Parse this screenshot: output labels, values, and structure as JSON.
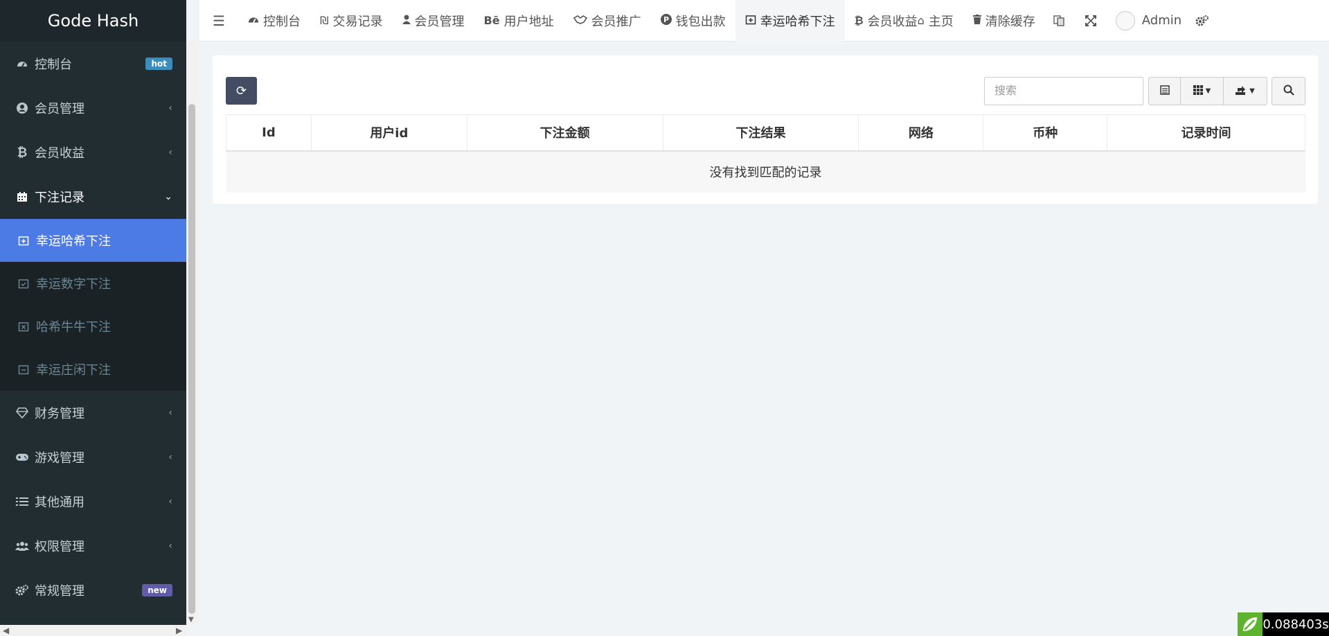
{
  "brand": "Gode Hash",
  "sidebar": {
    "items": [
      {
        "label": "控制台",
        "icon": "dashboard-icon",
        "badge": "hot"
      },
      {
        "label": "会员管理",
        "icon": "user-circle-icon"
      },
      {
        "label": "会员收益",
        "icon": "bitcoin-icon"
      },
      {
        "label": "下注记录",
        "icon": "calendar-icon",
        "open": true
      },
      {
        "label": "财务管理",
        "icon": "diamond-icon"
      },
      {
        "label": "游戏管理",
        "icon": "gamepad-icon"
      },
      {
        "label": "其他通用",
        "icon": "list-icon"
      },
      {
        "label": "权限管理",
        "icon": "users-icon"
      },
      {
        "label": "常规管理",
        "icon": "cogs-icon",
        "badge": "new"
      }
    ],
    "sub_items": [
      {
        "label": "幸运哈希下注",
        "icon": "calendar-plus-icon",
        "active": true
      },
      {
        "label": "幸运数字下注",
        "icon": "calendar-check-icon"
      },
      {
        "label": "哈希牛牛下注",
        "icon": "calendar-times-icon"
      },
      {
        "label": "幸运庄闲下注",
        "icon": "calendar-minus-icon"
      }
    ]
  },
  "topnav": {
    "tabs": [
      {
        "label": "控制台",
        "icon": "dashboard-icon"
      },
      {
        "label": "交易记录",
        "icon": "shekel-icon"
      },
      {
        "label": "会员管理",
        "icon": "user-icon"
      },
      {
        "label": "用户地址",
        "icon": "behance-icon"
      },
      {
        "label": "会员推广",
        "icon": "handshake-icon"
      },
      {
        "label": "钱包出款",
        "icon": "product-hunt-icon"
      },
      {
        "label": "幸运哈希下注",
        "icon": "calendar-plus-icon",
        "active": true
      },
      {
        "label": "会员收益",
        "icon": "bitcoin-icon"
      }
    ],
    "home_label": "主页",
    "clear_cache_label": "清除缓存",
    "user_name": "Admin"
  },
  "table": {
    "search_placeholder": "搜索",
    "columns": [
      "Id",
      "用户id",
      "下注金额",
      "下注结果",
      "网络",
      "币种",
      "记录时间"
    ],
    "empty_message": "没有找到匹配的记录"
  },
  "timer": "0.088403s",
  "colors": {
    "sidebar_bg": "#222d32",
    "active_item": "#4d7be5",
    "refresh_button": "#444c63",
    "hot_badge": "#3c8dbc",
    "new_badge": "#605ca8"
  }
}
